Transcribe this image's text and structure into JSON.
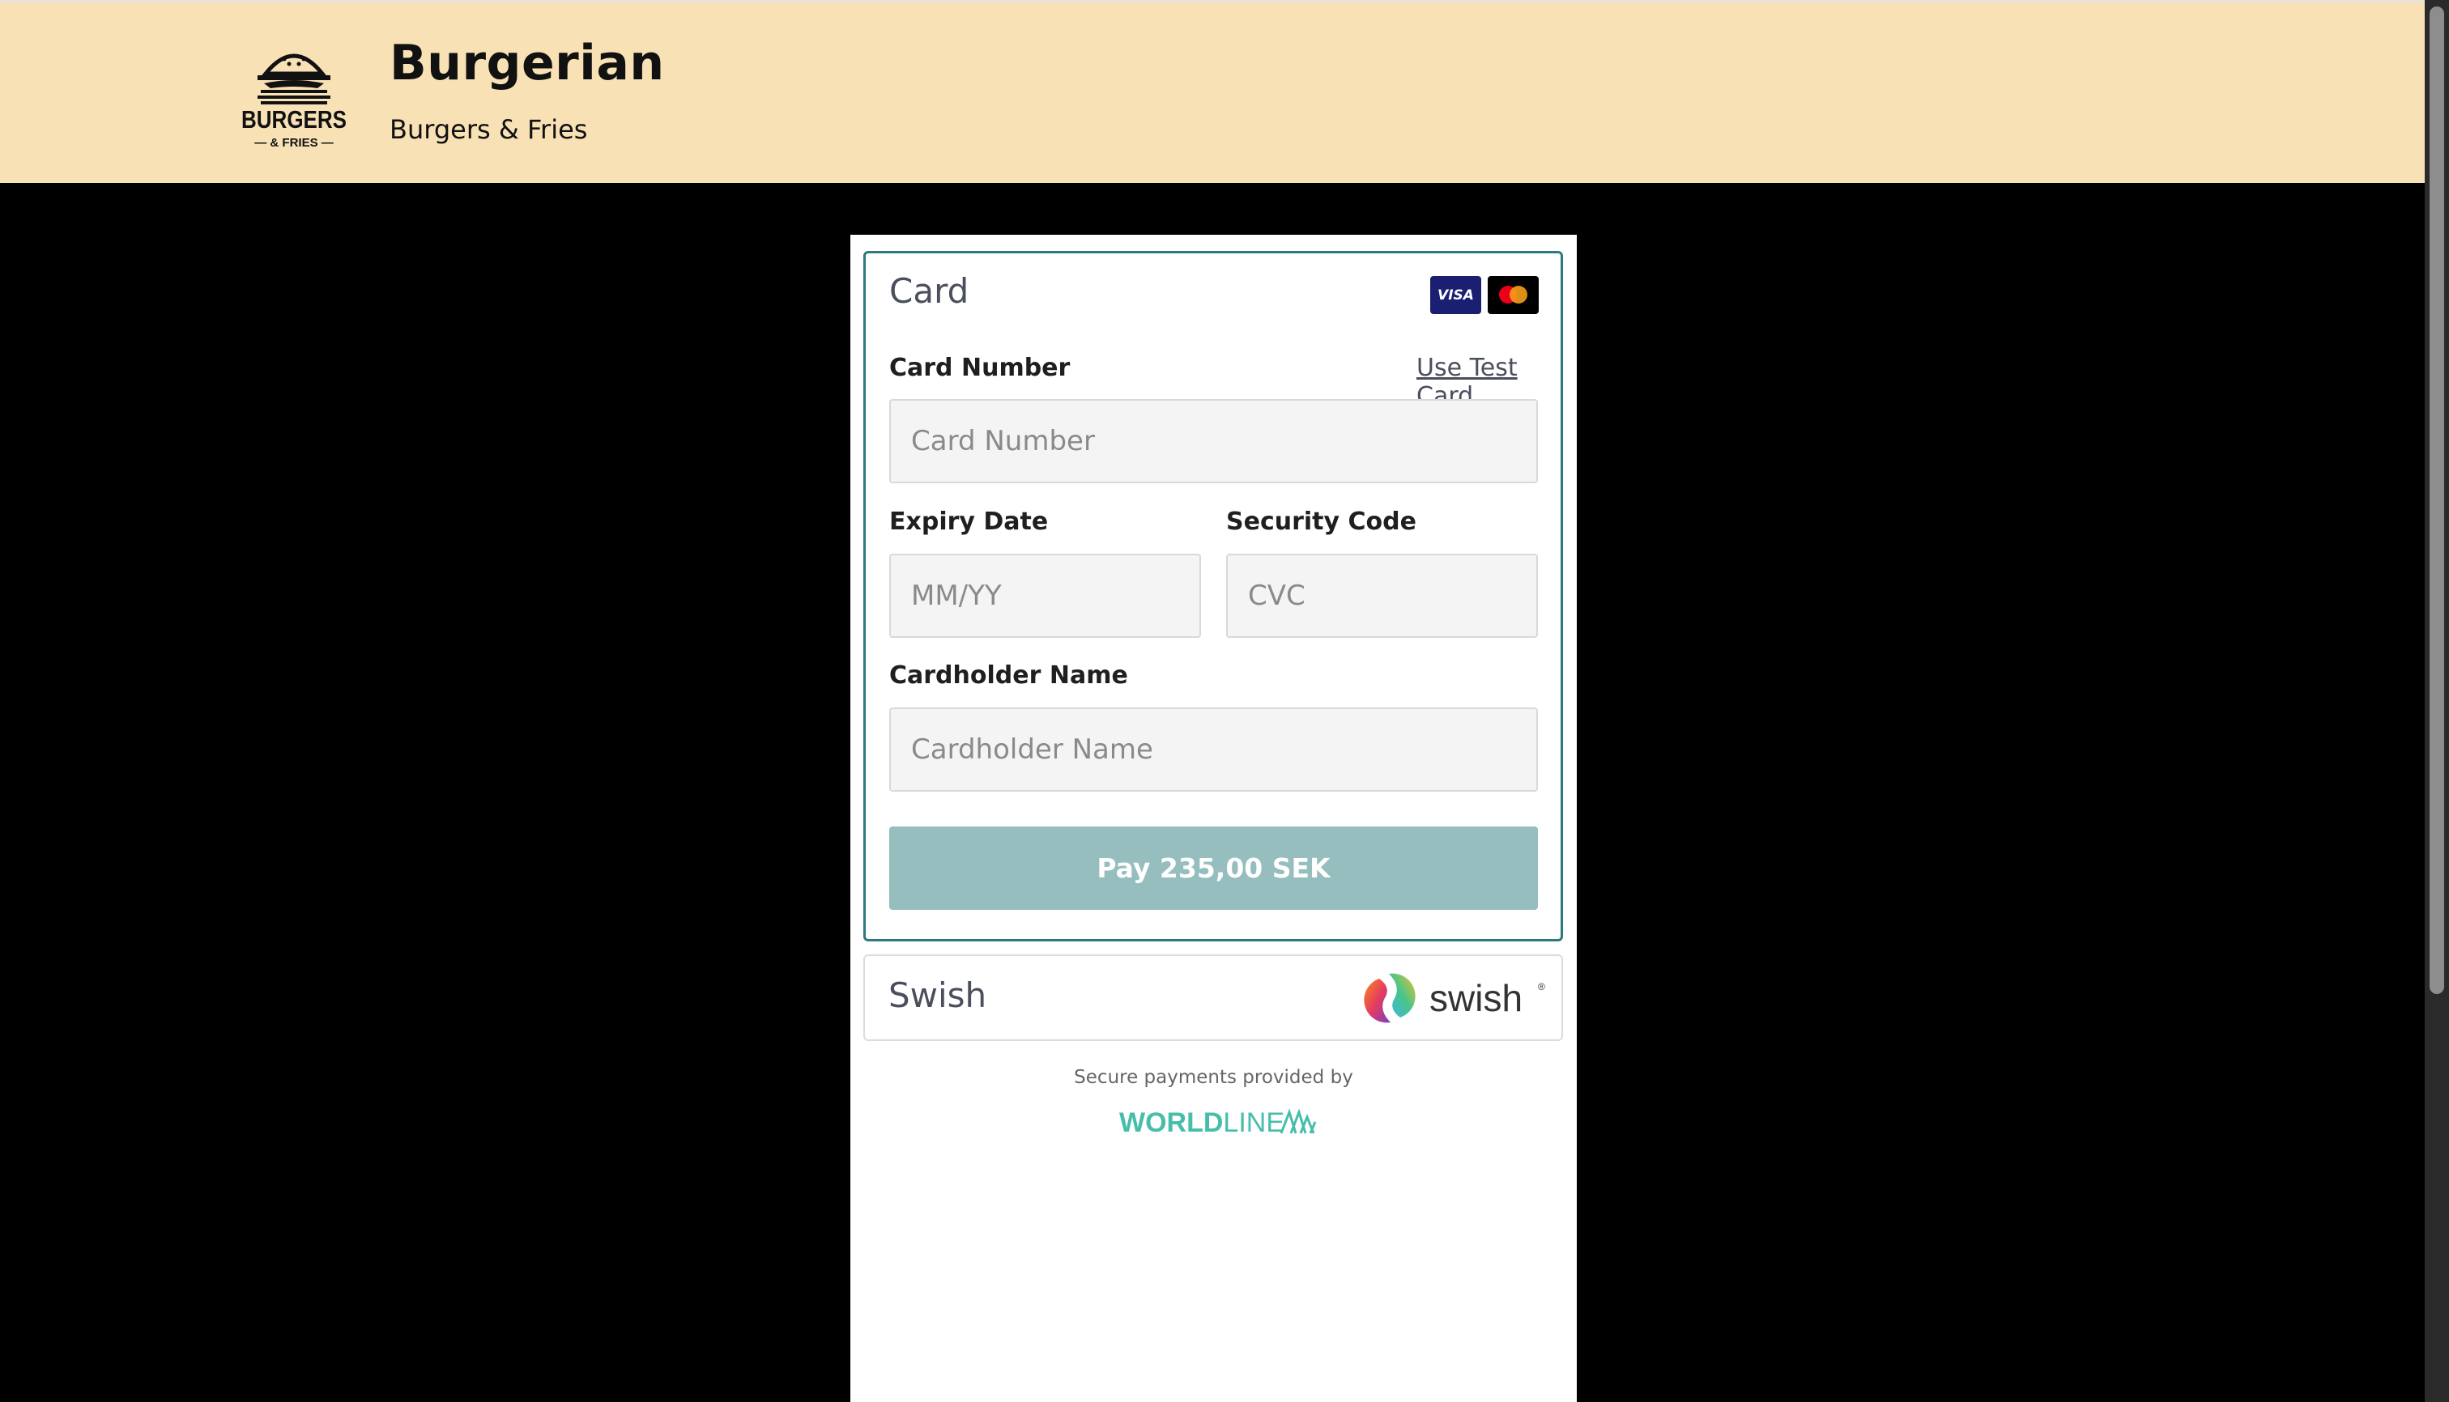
{
  "header": {
    "logo_text_main": "BURGERS",
    "logo_text_sub": "— & FRIES —",
    "title": "Burgerian",
    "subtitle": "Burgers & Fries"
  },
  "card_section": {
    "title": "Card",
    "brand_icons": [
      "visa-icon",
      "mastercard-icon"
    ],
    "visa_label": "VISA",
    "card_number": {
      "label": "Card Number",
      "placeholder": "Card Number",
      "value": ""
    },
    "use_test_card_label": "Use Test Card",
    "expiry": {
      "label": "Expiry Date",
      "placeholder": "MM/YY",
      "value": ""
    },
    "security_code": {
      "label": "Security Code",
      "placeholder": "CVC",
      "value": ""
    },
    "cardholder": {
      "label": "Cardholder Name",
      "placeholder": "Cardholder Name",
      "value": ""
    },
    "pay_button_label": "Pay 235,00 SEK"
  },
  "swish_section": {
    "title": "Swish",
    "logo_text": "swish"
  },
  "footer": {
    "secure_text": "Secure payments provided by",
    "provider_logo_text_bold": "WORLD",
    "provider_logo_text_light": "LINE"
  },
  "colors": {
    "header_bg": "#f9e1b6",
    "card_border": "#2b7a80",
    "pay_button_bg": "#97bebe",
    "worldline_teal": "#46beaa"
  }
}
